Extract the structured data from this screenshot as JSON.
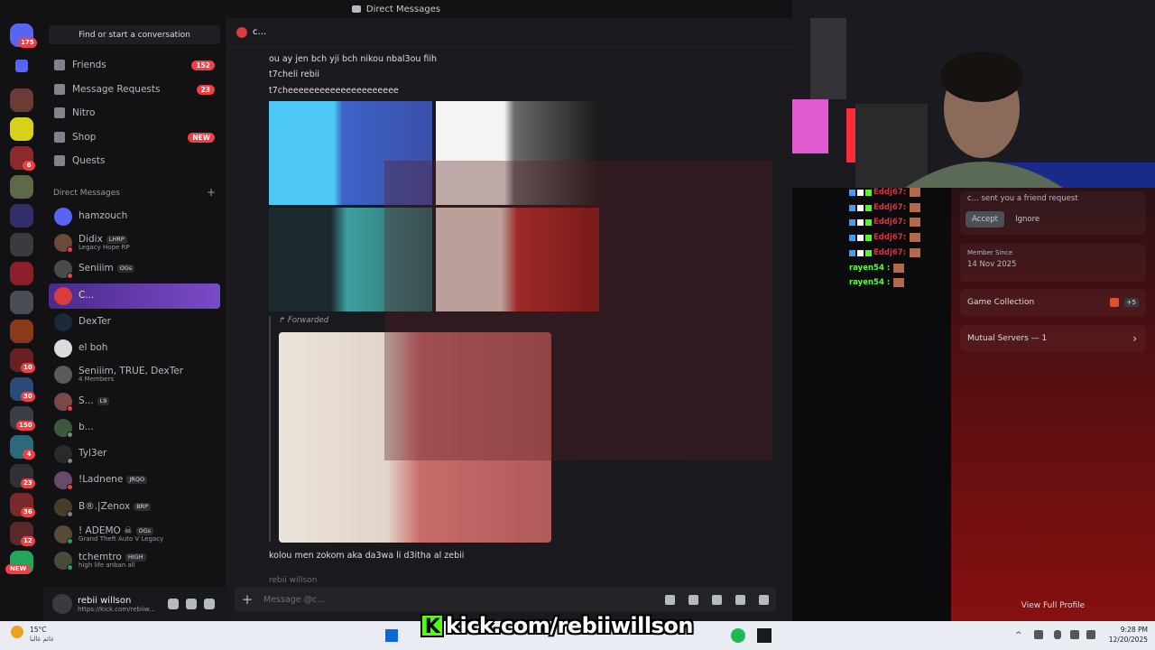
{
  "window": {
    "title": "Direct Messages"
  },
  "rail": {
    "home_badge": "175",
    "badges": [
      "6",
      "10",
      "30",
      "150",
      "4",
      "23",
      "36",
      "12"
    ],
    "new_label": "NEW"
  },
  "sidebar": {
    "search_placeholder": "Find or start a conversation",
    "nav": [
      {
        "label": "Friends",
        "count": "152",
        "icon": "friends-icon"
      },
      {
        "label": "Message Requests",
        "count": "23",
        "icon": "mail-icon"
      },
      {
        "label": "Nitro",
        "count": "",
        "icon": "nitro-icon"
      },
      {
        "label": "Shop",
        "count": "NEW",
        "icon": "shop-icon"
      },
      {
        "label": "Quests",
        "count": "",
        "icon": "quests-icon"
      }
    ],
    "dm_header": "Direct Messages",
    "dms": [
      {
        "name": "hamzouch",
        "tag": "",
        "sub": ""
      },
      {
        "name": "Didix",
        "tag": "LHRP",
        "sub": "Legacy Hope RP"
      },
      {
        "name": "Seniiim",
        "tag": "OGs",
        "sub": ""
      },
      {
        "name": "C...",
        "tag": "",
        "sub": ""
      },
      {
        "name": "DexTer",
        "tag": "",
        "sub": ""
      },
      {
        "name": "el boh",
        "tag": "",
        "sub": ""
      },
      {
        "name": "Seniiim, TRUE, DexTer",
        "tag": "",
        "sub": "4 Members"
      },
      {
        "name": "S...",
        "tag": "L9",
        "sub": ""
      },
      {
        "name": "b...",
        "tag": "",
        "sub": ""
      },
      {
        "name": "Tyl3er",
        "tag": "",
        "sub": ""
      },
      {
        "name": "!Ladnene",
        "tag": "JRQO",
        "sub": ""
      },
      {
        "name": "B®.|Zenox",
        "tag": "BRP",
        "sub": ""
      },
      {
        "name": "! ADEMO ☠",
        "tag": "OGs",
        "sub": "Grand Theft Auto V Legacy"
      },
      {
        "name": "tchemtro",
        "tag": "HIGH",
        "sub": "high life anban all"
      }
    ],
    "user": {
      "name": "rebii willson",
      "status": "https://kick.com/rebiiw..."
    }
  },
  "chat": {
    "header_name": "c...",
    "messages": [
      "ou ay jen bch yji bch nikou nbal3ou fiih",
      "t7cheli rebii",
      "t7cheeeeeeeeeeeeeeeeeeeee"
    ],
    "forwarded_label": "Forwarded",
    "last_message": "kolou men zokom aka da3wa li d3itha al zebii",
    "next_author": "rebii willson",
    "input_placeholder": "Message @c..."
  },
  "stream_chat": [
    {
      "user": "Eddj67",
      "color": "#e0323a"
    },
    {
      "user": "Eddj67",
      "color": "#e0323a"
    },
    {
      "user": "Eddj67",
      "color": "#e0323a"
    },
    {
      "user": "Eddj67",
      "color": "#e0323a"
    },
    {
      "user": "Eddj67",
      "color": "#e0323a"
    },
    {
      "user": "rayen54",
      "color": "#5cff3a"
    },
    {
      "user": "rayen54",
      "color": "#5cff3a"
    }
  ],
  "profile": {
    "request_text": "c... sent you a friend request",
    "accept": "Accept",
    "ignore": "Ignore",
    "member_since_label": "Member Since",
    "member_since": "14 Nov 2025",
    "game_collection": "Game Collection",
    "game_more": "+5",
    "mutual_servers": "Mutual Servers — 1",
    "view_full": "View Full Profile"
  },
  "taskbar": {
    "weather_temp": "15°C",
    "weather_desc": "غائم غالبا",
    "time": "9:28 PM",
    "date": "12/20/2025",
    "watermark": "kick.com/rebiiwillson",
    "watermark_k": "K"
  },
  "colors": {
    "accent": "#5865f2",
    "danger": "#f23f43",
    "kick": "#53fc18"
  }
}
